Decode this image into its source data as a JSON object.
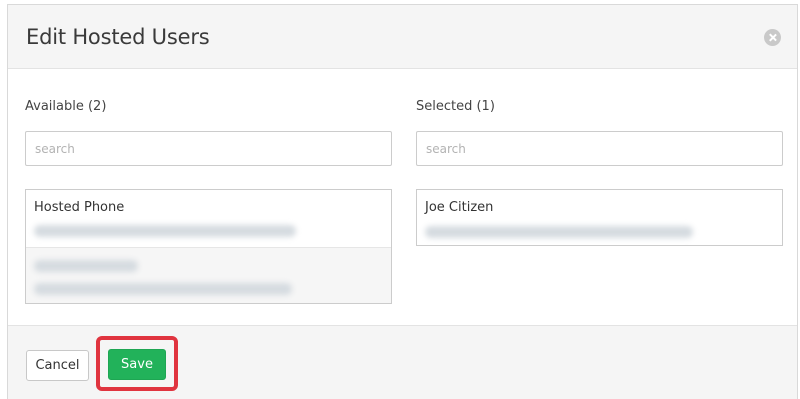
{
  "dialog": {
    "title": "Edit Hosted Users"
  },
  "available": {
    "label": "Available (2)",
    "search_placeholder": "search",
    "items": [
      {
        "name": "Hosted Phone"
      },
      {
        "name": ""
      }
    ]
  },
  "selected": {
    "label": "Selected (1)",
    "search_placeholder": "search",
    "items": [
      {
        "name": "Joe Citizen"
      }
    ]
  },
  "footer": {
    "cancel_label": "Cancel",
    "save_label": "Save"
  },
  "colors": {
    "save_button": "#22b25a",
    "highlight": "#e0343f",
    "header_bg": "#f5f5f5"
  },
  "icons": {
    "close": "close-circle-icon"
  }
}
